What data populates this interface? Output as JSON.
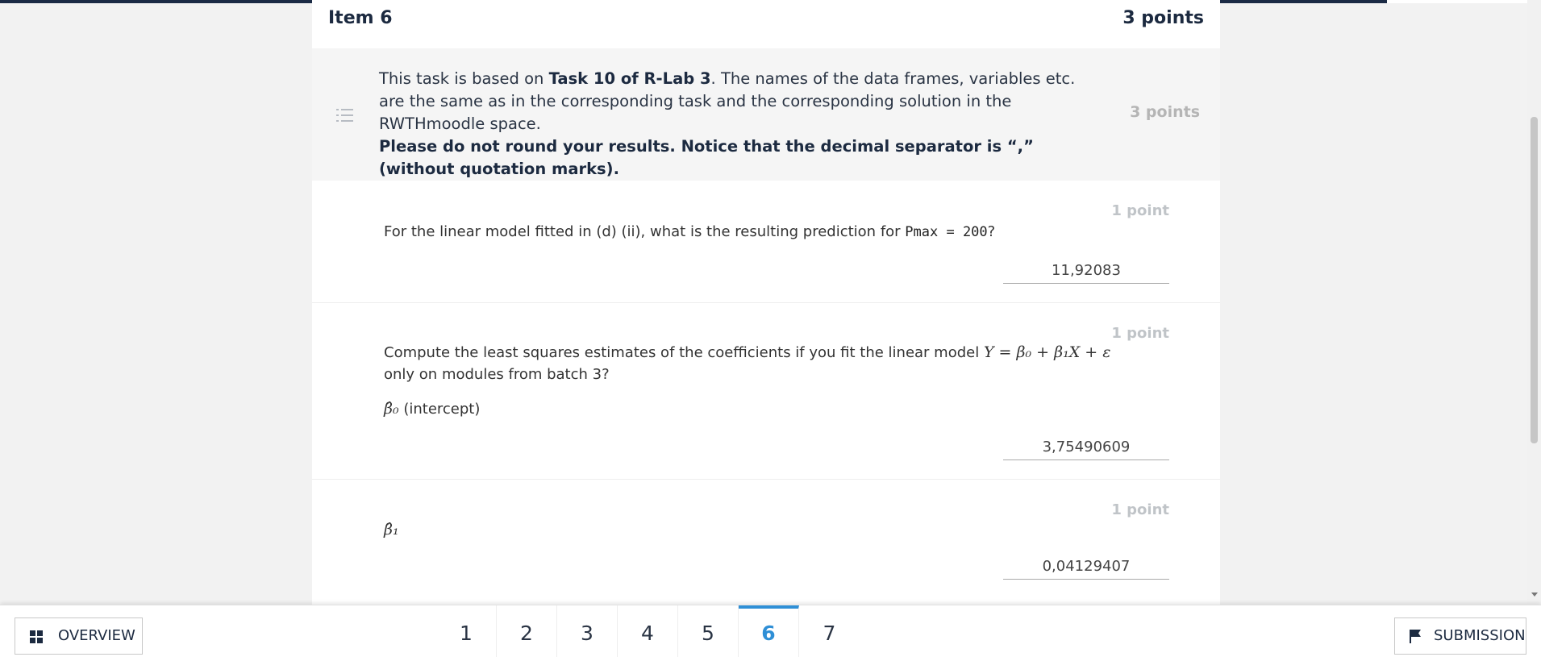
{
  "item": {
    "title": "Item 6",
    "points": "3 points"
  },
  "intro": {
    "text_part1": "This task is based on ",
    "task_ref": "Task 10 of R-Lab 3",
    "text_part2": ". The names of the data frames, variables etc. are the same as in the corresponding task and the corresponding solution in the RWTHmoodle space.",
    "instruction": "Please do not round your results. Notice that the decimal separator is “,” (without quotation marks).",
    "points": "3 points"
  },
  "questions": [
    {
      "points": "1 point",
      "text_before": "For the linear model fitted in (d) (ii), what is the resulting prediction for ",
      "code": "Pmax = 200",
      "text_after": "?",
      "answer": "11,92083"
    },
    {
      "points": "1 point",
      "text_before": "Compute the least squares estimates of the coefficients if you fit the linear model ",
      "formula": "Y = β₀ + β₁X + ε",
      "text_after": " only on modules from batch 3?",
      "sub_symbol": "β̂₀",
      "sub_label": " (intercept)",
      "answer": "3,75490609"
    },
    {
      "points": "1 point",
      "sub_symbol": "β̂₁",
      "answer": "0,04129407"
    }
  ],
  "footer": {
    "overview_label": "OVERVIEW",
    "submission_label": "SUBMISSION",
    "pages": [
      "1",
      "2",
      "3",
      "4",
      "5",
      "6",
      "7"
    ],
    "active_page": "6"
  },
  "colors": {
    "accent": "#2f8fd6",
    "header_bar": "#1b2b45",
    "text_dark": "#1c2a40",
    "muted_points": "#c0c4c8"
  },
  "icons": {
    "intro": "list-icon",
    "overview": "grid-icon",
    "submission": "flag-icon"
  }
}
